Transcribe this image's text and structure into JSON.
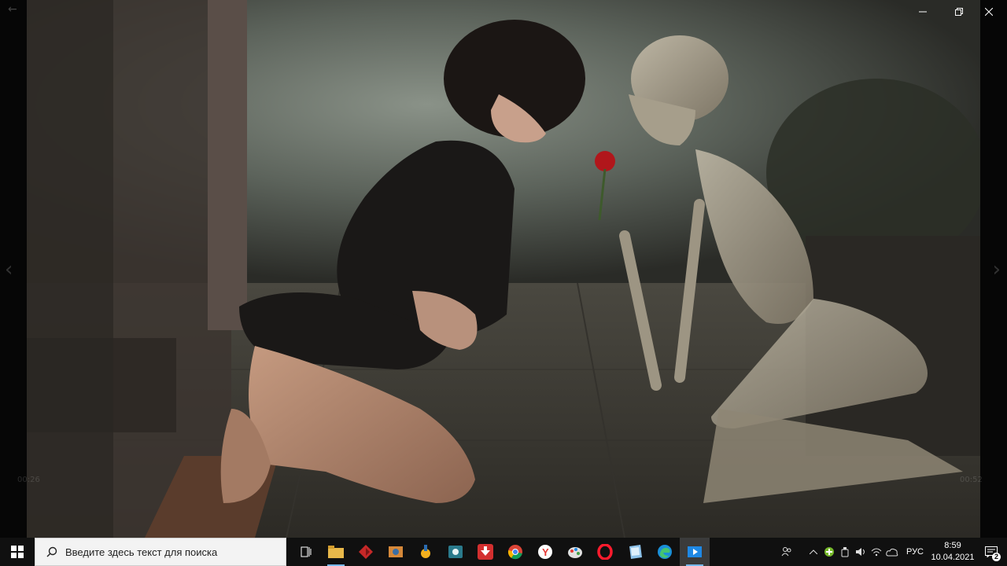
{
  "viewer": {
    "media_time_elapsed": "00:26",
    "media_time_total": "00:52"
  },
  "window_controls": {
    "minimize_icon": "minimize-icon",
    "maximize_icon": "restore-icon",
    "close_icon": "close-icon"
  },
  "taskbar": {
    "search_placeholder": "Введите здесь текст для поиска",
    "apps": [
      {
        "name": "task-view",
        "icon": "task-view-icon"
      },
      {
        "name": "file-explorer",
        "icon": "folder-icon"
      },
      {
        "name": "app-red-diamond",
        "icon": "red-diamond-icon"
      },
      {
        "name": "app-photo-editor",
        "icon": "photo-editor-icon"
      },
      {
        "name": "app-torrent",
        "icon": "torrent-icon"
      },
      {
        "name": "app-recorder",
        "icon": "recorder-icon"
      },
      {
        "name": "app-download",
        "icon": "download-icon"
      },
      {
        "name": "chrome",
        "icon": "chrome-icon"
      },
      {
        "name": "yandex-browser",
        "icon": "yandex-icon"
      },
      {
        "name": "app-paint",
        "icon": "paint-icon"
      },
      {
        "name": "opera",
        "icon": "opera-icon"
      },
      {
        "name": "app-notes",
        "icon": "notes-icon"
      },
      {
        "name": "edge",
        "icon": "edge-icon"
      },
      {
        "name": "photos-video",
        "icon": "video-player-icon"
      }
    ],
    "tray": {
      "language": "РУС",
      "time": "8:59",
      "date": "10.04.2021",
      "notification_count": "2"
    }
  },
  "colors": {
    "taskbar_bg": "#101010",
    "accent": "#76b9ed",
    "search_bg": "#f3f3f3"
  }
}
